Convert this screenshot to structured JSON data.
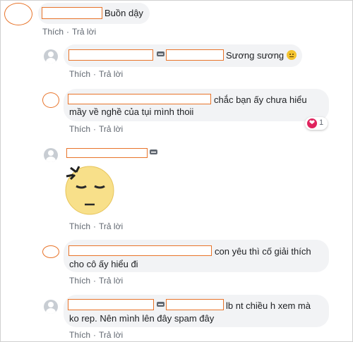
{
  "actions": {
    "like": "Thích",
    "reply": "Trả lời",
    "sep": "·"
  },
  "comments": [
    {
      "text": "Buồn dậy"
    },
    {
      "text": "Sương sương"
    },
    {
      "text_line1": "chắc bạn ấy chưa hiểu",
      "text_line2": "mầy về nghề của tụi mình thoii",
      "reaction": {
        "icon": "heart-icon",
        "count": "1"
      }
    },
    {
      "sticker": "angry-face-sticker"
    },
    {
      "text_line1": "con yêu thì cố giải thích",
      "text_line2": "cho cô ấy hiểu đi"
    },
    {
      "text_line1": "lb nt chiều h xem mà",
      "text_line2": "ko rep. Nên mình lên đây spam đây"
    }
  ],
  "colors": {
    "bubble": "#f2f3f5",
    "redact_border": "#e8742a",
    "action_text": "#606770",
    "heart": "#e0245e"
  }
}
